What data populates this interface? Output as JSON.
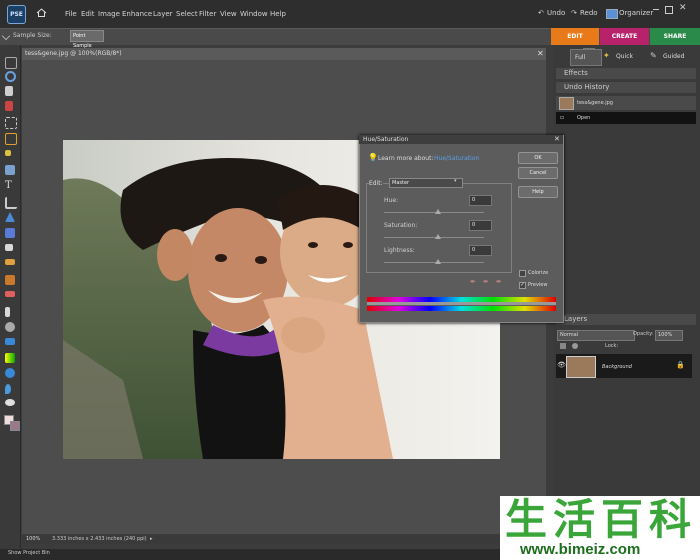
{
  "app": {
    "logo": "PSE"
  },
  "menu": [
    "File",
    "Edit",
    "Image",
    "Enhance",
    "Layer",
    "Select",
    "Filter",
    "View",
    "Window",
    "Help"
  ],
  "topbar": {
    "undo": "Undo",
    "redo": "Redo",
    "organizer": "Organizer"
  },
  "modes": {
    "edit": "EDIT",
    "create": "CREATE",
    "share": "SHARE"
  },
  "options": {
    "sample_size_label": "Sample Size:",
    "sample_size_value": "Point Sample"
  },
  "subtabs": {
    "full": "Full",
    "quick": "Quick",
    "guided": "Guided"
  },
  "document": {
    "title": "tess&gene.jpg @ 100%(RGB/8*)",
    "zoom": "100%",
    "dimensions": "3.333 inches x 2.433 inches (240 ppi)"
  },
  "panels": {
    "effects": "Effects",
    "undo_history": "Undo History",
    "history_items": [
      "tess&gene.jpg",
      "Open"
    ],
    "layers": "Layers",
    "blend_mode": "Normal",
    "opacity_label": "Opacity:",
    "opacity_value": "100%",
    "lock_label": "Lock:",
    "layer_name": "Background"
  },
  "dialog": {
    "title": "Hue/Saturation",
    "learn_more": "Learn more about:",
    "learn_more_link": "Hue/Saturation",
    "ok": "OK",
    "cancel": "Cancel",
    "help": "Help",
    "edit_label": "Edit:",
    "edit_value": "Master",
    "hue_label": "Hue:",
    "hue_value": "0",
    "saturation_label": "Saturation:",
    "saturation_value": "0",
    "lightness_label": "Lightness:",
    "lightness_value": "0",
    "colorize": "Colorize",
    "preview": "Preview"
  },
  "bottom": {
    "project_bin": "Show Project Bin"
  },
  "watermark": {
    "chars": [
      "生",
      "活",
      "百",
      "科"
    ],
    "url": "www.bimeiz.com"
  },
  "colors": {
    "edit_tab": "#e87a1a",
    "create_tab": "#b8226a",
    "share_tab": "#2a8a4a",
    "history_selected": "#121212"
  },
  "icons": [
    "home-icon",
    "move-tool-icon",
    "zoom-tool-icon",
    "hand-tool-icon",
    "eyedropper-tool-icon",
    "marquee-tool-icon",
    "lasso-tool-icon",
    "magic-wand-icon",
    "type-tool-icon",
    "crop-tool-icon",
    "brush-tool-icon",
    "eraser-tool-icon",
    "lightbulb-icon",
    "lock-icon",
    "eye-icon"
  ]
}
